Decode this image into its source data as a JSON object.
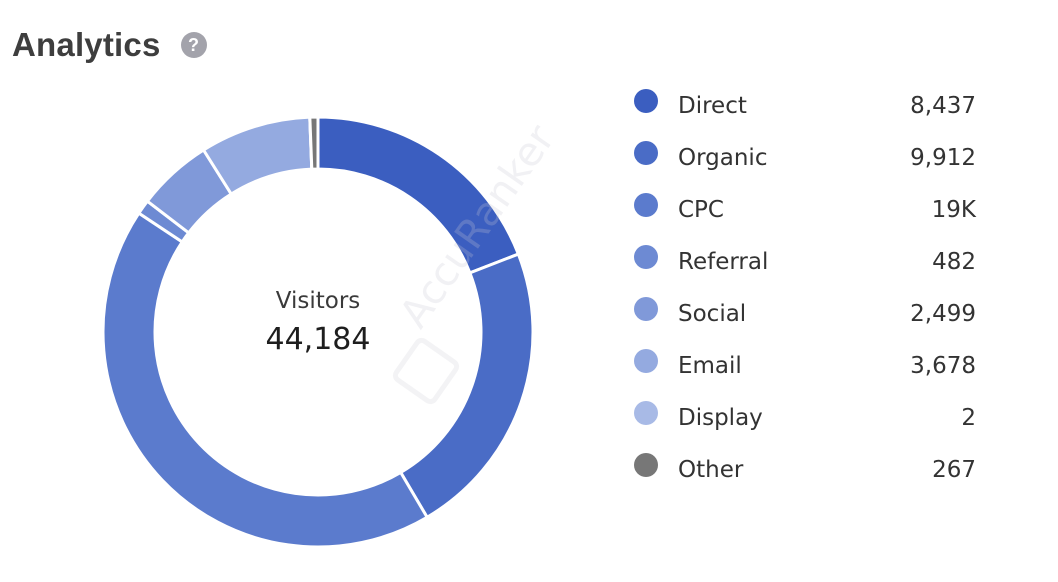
{
  "header": {
    "title": "Analytics",
    "help_icon": "question-circle-icon",
    "help_glyph": "?"
  },
  "watermark": "AccuRanker",
  "chart_data": {
    "type": "pie",
    "variant": "donut",
    "title": "Analytics",
    "center_label": "Visitors",
    "center_value": "44,184",
    "total": 44184,
    "legend_position": "right",
    "series": [
      {
        "name": "Direct",
        "value": 8437,
        "display": "8,437",
        "color": "#3b5ec0"
      },
      {
        "name": "Organic",
        "value": 9912,
        "display": "9,912",
        "color": "#4a6cc6"
      },
      {
        "name": "CPC",
        "value": 18907,
        "display": "19K",
        "color": "#5b7bcd"
      },
      {
        "name": "Referral",
        "value": 482,
        "display": "482",
        "color": "#6d8ad3"
      },
      {
        "name": "Social",
        "value": 2499,
        "display": "2,499",
        "color": "#8099d9"
      },
      {
        "name": "Email",
        "value": 3678,
        "display": "3,678",
        "color": "#94aae0"
      },
      {
        "name": "Display",
        "value": 2,
        "display": "2",
        "color": "#a8bae6"
      },
      {
        "name": "Other",
        "value": 267,
        "display": "267",
        "color": "#777777"
      }
    ]
  }
}
